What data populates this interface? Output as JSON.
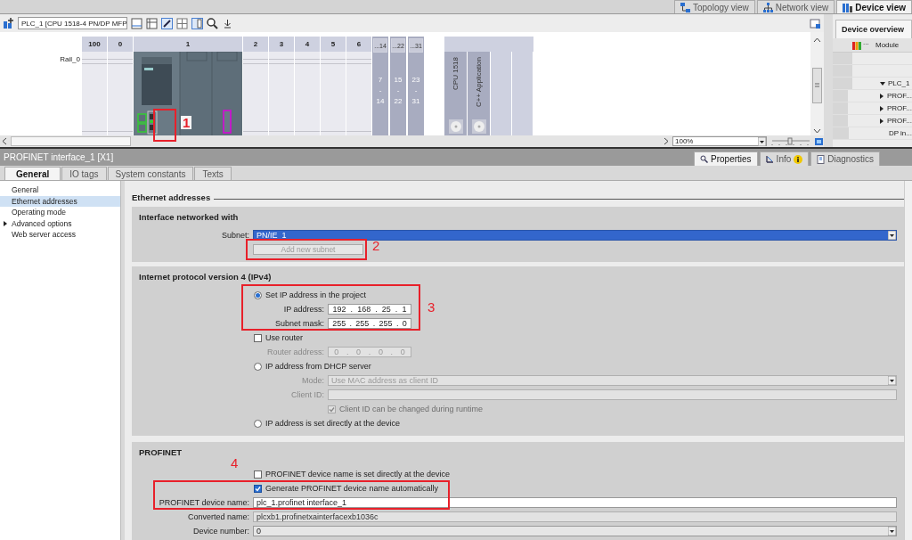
{
  "view_tabs": [
    {
      "label": "Topology view",
      "selected": false
    },
    {
      "label": "Network view",
      "selected": false
    },
    {
      "label": "Device view",
      "selected": true
    }
  ],
  "device_toolbar": {
    "device_select": "PLC_1 [CPU 1518-4 PN/DP MFP"
  },
  "rack": {
    "rail": "Rail_0",
    "slots": [
      "100",
      "0",
      "1",
      "2",
      "3",
      "4",
      "5",
      "6"
    ],
    "expansion_slots": [
      {
        "label": "...14",
        "range_start": "7",
        "range_sep": "-",
        "range_end": "14"
      },
      {
        "label": "...22",
        "range_start": "15",
        "range_sep": "-",
        "range_end": "22"
      },
      {
        "label": "...31",
        "range_start": "23",
        "range_sep": "-",
        "range_end": "31"
      }
    ],
    "modules": [
      "CPU 1518",
      "C++ Application"
    ]
  },
  "zoom": "100%",
  "zoom_slider": {
    "level": 0.5
  },
  "device_overview": {
    "title": "Device overview",
    "columns": [
      "...",
      "Module"
    ],
    "rows": [
      {
        "module": "PLC_1",
        "kind": "group",
        "expanded": true,
        "children": [
          {
            "module": "PROF...",
            "kind": "group",
            "expanded": false
          },
          {
            "module": "PROF...",
            "kind": "group",
            "expanded": false
          },
          {
            "module": "PROF...",
            "kind": "group",
            "expanded": false
          },
          {
            "module": "DP in...",
            "kind": "leaf"
          }
        ]
      }
    ]
  },
  "inspector": {
    "title": "PROFINET interface_1 [X1]",
    "tabs": [
      {
        "label": "Properties",
        "selected": true
      },
      {
        "label": "Info",
        "selected": false
      },
      {
        "label": "Diagnostics",
        "selected": false
      }
    ]
  },
  "property_tabs": [
    {
      "label": "General",
      "selected": true
    },
    {
      "label": "IO tags",
      "selected": false
    },
    {
      "label": "System constants",
      "selected": false
    },
    {
      "label": "Texts",
      "selected": false
    }
  ],
  "nav": [
    {
      "label": "General",
      "selected": false,
      "kind": "item"
    },
    {
      "label": "Ethernet addresses",
      "selected": true,
      "kind": "item"
    },
    {
      "label": "Operating mode",
      "selected": false,
      "kind": "item"
    },
    {
      "label": "Advanced options",
      "selected": false,
      "kind": "group",
      "expanded": false
    },
    {
      "label": "Web server access",
      "selected": false,
      "kind": "item"
    }
  ],
  "content": {
    "heading": "Ethernet addresses",
    "interface_networked": {
      "title": "Interface networked with",
      "subnet_label": "Subnet:",
      "subnet": "PN/IE_1",
      "add_subnet_button": {
        "label": "Add new subnet",
        "disabled": true
      }
    },
    "ipv4": {
      "title": "Internet protocol version 4 (IPv4)",
      "set_in_project": {
        "label": "Set IP address in the project",
        "selected": true
      },
      "ip_address": {
        "label": "IP address:",
        "octets": [
          "192",
          "168",
          "25",
          "1"
        ],
        "separator": ".",
        "disabled": false
      },
      "subnet_mask": {
        "label": "Subnet mask:",
        "octets": [
          "255",
          "255",
          "255",
          "0"
        ],
        "separator": ".",
        "disabled": false
      },
      "use_router": {
        "label": "Use router",
        "checked": false
      },
      "router_address": {
        "label": "Router address:",
        "octets": [
          "0",
          "0",
          "0",
          "0"
        ],
        "separator": ".",
        "disabled": true
      },
      "dhcp": {
        "label": "IP address from DHCP server",
        "selected": false
      },
      "mode": {
        "label": "Mode:",
        "value": "Use MAC address as client ID",
        "disabled": true
      },
      "client_id": {
        "label": "Client ID:",
        "disabled": true
      },
      "client_id_changeable": {
        "label": "Client ID can be changed during runtime",
        "checked": true,
        "disabled": true
      },
      "set_at_device": {
        "label": "IP address is set directly at the device",
        "selected": false
      }
    },
    "profinet": {
      "title": "PROFINET",
      "name_at_device": {
        "label": "PROFINET device name is set directly at the device",
        "checked": false
      },
      "generate_name": {
        "label": "Generate PROFINET device name automatically",
        "checked": true
      },
      "device_name": {
        "label": "PROFINET device name:",
        "value": "plc_1.profinet interface_1"
      },
      "converted_name": {
        "label": "Converted name:",
        "value": "plcxb1.profinetxainterfacexb1036c"
      },
      "device_number": {
        "label": "Device number:",
        "value": "0"
      }
    }
  },
  "annotations": [
    {
      "label": "1"
    },
    {
      "label": "2"
    },
    {
      "label": "3"
    },
    {
      "label": "4"
    }
  ]
}
